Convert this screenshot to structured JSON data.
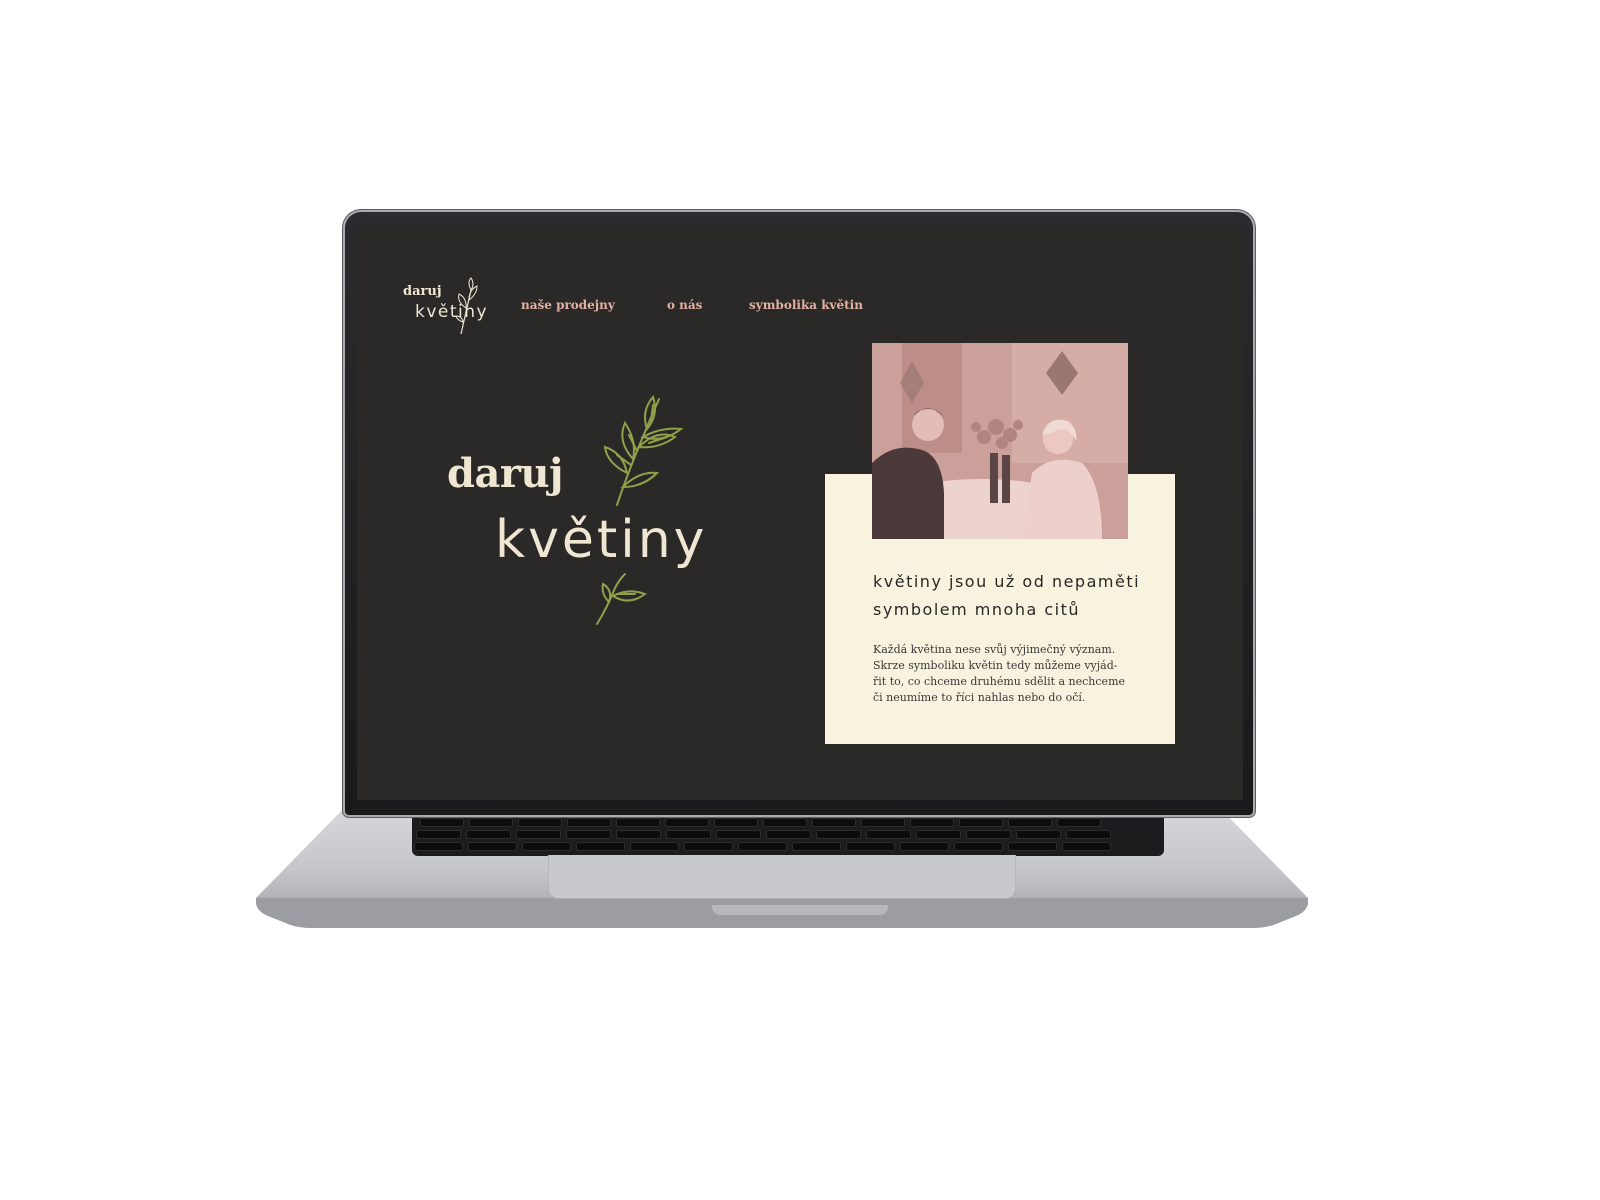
{
  "site": {
    "logo": {
      "line1": "daruj",
      "line2": "květiny"
    },
    "nav": [
      {
        "label": "naše prodejny"
      },
      {
        "label": "o nás"
      },
      {
        "label": "symbolika květin"
      }
    ],
    "hero": {
      "line1": "daruj",
      "line2": "květiny"
    },
    "card": {
      "title_line1": "květiny jsou už od nepaměti",
      "title_line2": "symbolem mnoha citů",
      "text_lines": [
        "Každá květina nese svůj výjimečný význam.",
        "Skrze symboliku květin tedy můžeme vyjád-",
        "řit to, co chceme druhému sdělit a nechceme",
        "či neumíme to říci nahlas nebo do očí."
      ]
    }
  },
  "colors": {
    "page_bg": "#2a2928",
    "cream": "#efe7d2",
    "nav_link": "#e3b1a3",
    "leaf_green": "#8fa24a",
    "card_bg": "#f8f3df",
    "photo_tint": "#c89f99"
  },
  "icons": [
    "leaf-sprig-icon",
    "small-sprig-icon",
    "touch-bar-icon"
  ]
}
